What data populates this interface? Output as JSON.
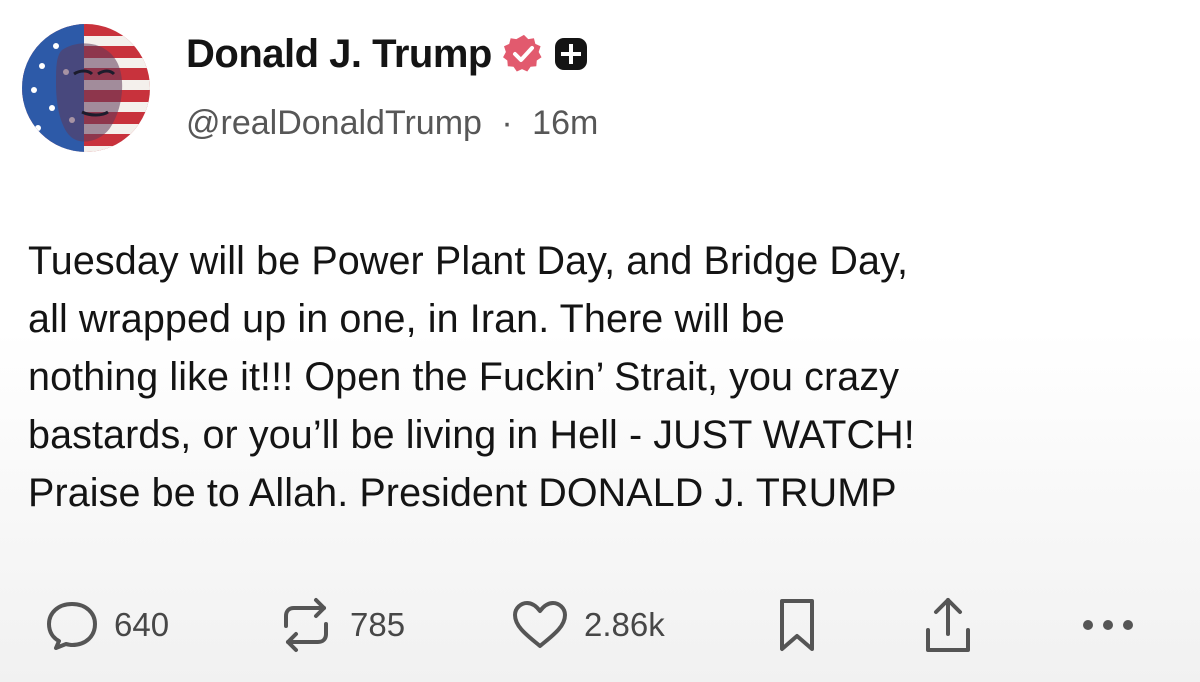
{
  "author": {
    "display_name": "Donald J. Trump",
    "handle": "@realDonaldTrump",
    "separator": "·",
    "time_ago": "16m",
    "verified_badge_color": "#e25a6e"
  },
  "post": {
    "lines": [
      "Tuesday will be Power Plant Day, and Bridge Day,",
      "all wrapped up in one, in Iran. There will be",
      "nothing like it!!! Open the Fuckin’ Strait, you crazy",
      "bastards, or you’ll be living in Hell - JUST WATCH!",
      "Praise be to Allah. President DONALD J. TRUMP"
    ]
  },
  "actions": {
    "replies": "640",
    "reposts": "785",
    "likes": "2.86k",
    "icons": [
      "reply-icon",
      "repost-icon",
      "heart-icon",
      "bookmark-icon",
      "share-icon",
      "more-icon"
    ]
  }
}
